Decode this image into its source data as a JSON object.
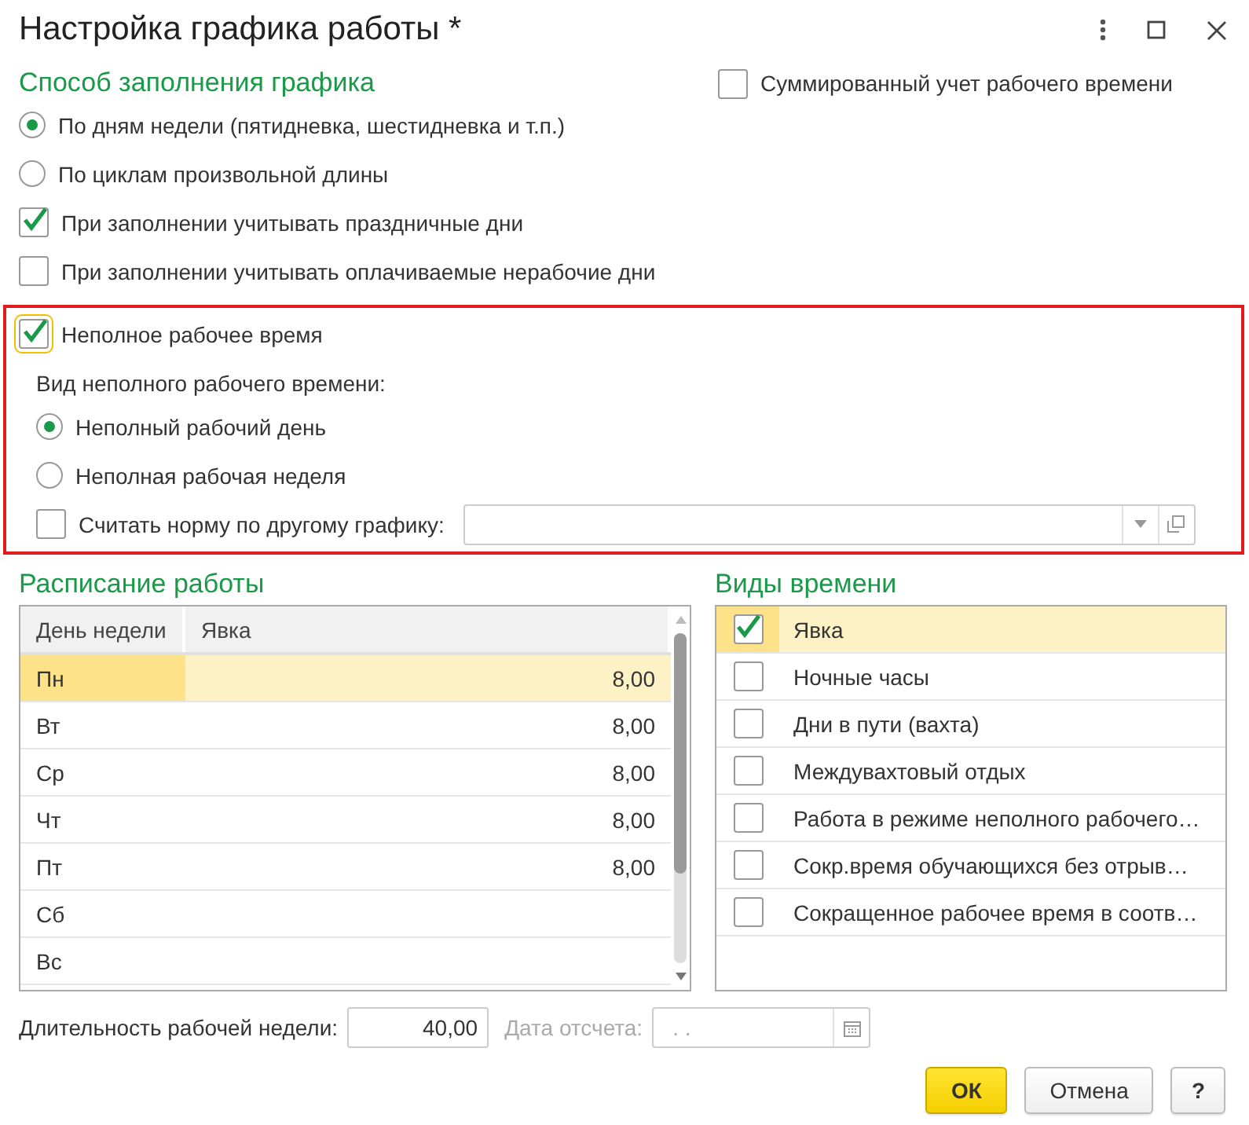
{
  "window": {
    "title": "Настройка графика работы *"
  },
  "fill_method": {
    "heading": "Способ заполнения графика",
    "options": [
      {
        "label": "По дням недели (пятидневка, шестидневка и т.п.)",
        "selected": true
      },
      {
        "label": "По циклам произвольной длины",
        "selected": false
      }
    ]
  },
  "summed": {
    "label": "Суммированный учет рабочего времени",
    "checked": false
  },
  "fill_checks": [
    {
      "label": "При заполнении учитывать праздничные дни",
      "checked": true
    },
    {
      "label": "При заполнении учитывать оплачиваемые нерабочие дни",
      "checked": false
    }
  ],
  "part_time": {
    "label": "Неполное рабочее время",
    "checked": true,
    "kind_label": "Вид неполного рабочего времени:",
    "kinds": [
      {
        "label": "Неполный рабочий день",
        "selected": true
      },
      {
        "label": "Неполная рабочая неделя",
        "selected": false
      }
    ],
    "norm": {
      "label": "Считать норму по другому графику:",
      "checked": false
    }
  },
  "schedule": {
    "heading": "Расписание работы",
    "columns": [
      "День недели",
      "Явка"
    ],
    "rows": [
      {
        "day": "Пн",
        "hours": "8,00",
        "selected": true
      },
      {
        "day": "Вт",
        "hours": "8,00",
        "selected": false
      },
      {
        "day": "Ср",
        "hours": "8,00",
        "selected": false
      },
      {
        "day": "Чт",
        "hours": "8,00",
        "selected": false
      },
      {
        "day": "Пт",
        "hours": "8,00",
        "selected": false
      },
      {
        "day": "Сб",
        "selected": false
      },
      {
        "day": "Вс",
        "selected": false
      }
    ]
  },
  "time_types": {
    "heading": "Виды времени",
    "items": [
      {
        "label": "Явка",
        "checked": true,
        "selected": true
      },
      {
        "label": "Ночные часы",
        "checked": false,
        "selected": false
      },
      {
        "label": "Дни в пути (вахта)",
        "checked": false,
        "selected": false
      },
      {
        "label": "Междувахтовый отдых",
        "checked": false,
        "selected": false
      },
      {
        "label": "Работа в режиме неполного рабочего…",
        "checked": false,
        "selected": false
      },
      {
        "label": "Сокр.время обучающихся без отрыв…",
        "checked": false,
        "selected": false
      },
      {
        "label": "Сокращенное рабочее время в соотв…",
        "checked": false,
        "selected": false
      }
    ]
  },
  "week_length": {
    "label": "Длительность рабочей недели:",
    "value": "40,00"
  },
  "ref_date": {
    "label": "Дата отсчета:",
    "value": ". .",
    "disabled": true
  },
  "buttons": [
    {
      "label": "ОК",
      "kind": "primary"
    },
    {
      "label": "Отмена",
      "kind": "normal"
    },
    {
      "label": "?",
      "kind": "normal"
    }
  ]
}
